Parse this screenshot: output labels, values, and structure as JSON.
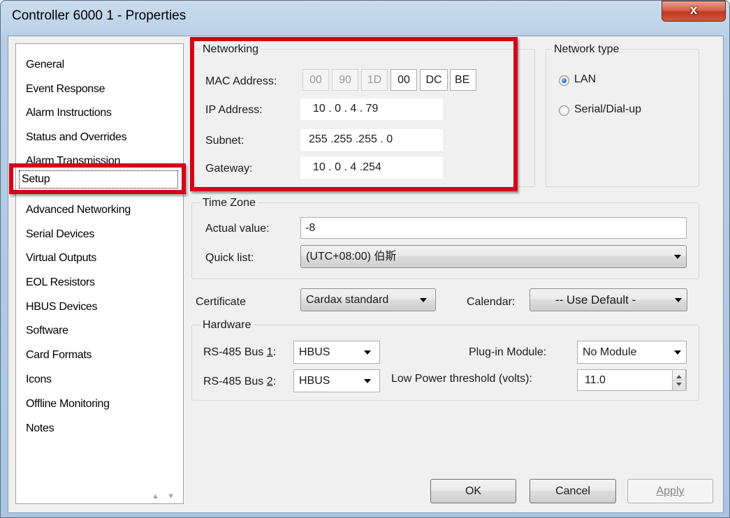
{
  "window": {
    "title": "Controller 6000 1 - Properties",
    "close_glyph": "x"
  },
  "nav": {
    "items": [
      {
        "label": "General"
      },
      {
        "label": "Event Response"
      },
      {
        "label": "Alarm Instructions"
      },
      {
        "label": "Status and Overrides"
      },
      {
        "label": "Alarm Transmission"
      },
      {
        "label": "Setup",
        "selected": true
      },
      {
        "label": "Advanced Networking"
      },
      {
        "label": "Serial Devices"
      },
      {
        "label": "Virtual Outputs"
      },
      {
        "label": "EOL Resistors"
      },
      {
        "label": "HBUS Devices"
      },
      {
        "label": "Software"
      },
      {
        "label": "Card Formats"
      },
      {
        "label": "Icons"
      },
      {
        "label": "Offline Monitoring"
      },
      {
        "label": "Notes"
      }
    ],
    "scroll_arrows": "▲ ▼"
  },
  "networking": {
    "title": "Networking",
    "mac_label": "MAC Address:",
    "mac": [
      "00",
      "90",
      "1D",
      "00",
      "DC",
      "BE"
    ],
    "ip_label": "IP Address:",
    "ip_value": "10 . 0 . 4 . 79",
    "subnet_label": "Subnet:",
    "subnet_value": "255 .255 .255 . 0",
    "gateway_label": "Gateway:",
    "gateway_value": "10 . 0 . 4 .254"
  },
  "network_type": {
    "title": "Network type",
    "options": [
      {
        "label": "LAN",
        "checked": true
      },
      {
        "label": "Serial/Dial-up",
        "checked": false
      }
    ]
  },
  "time_zone": {
    "title": "Time Zone",
    "actual_label": "Actual value:",
    "actual_value": "-8",
    "quick_label": "Quick list:",
    "quick_value": "(UTC+08:00) 伯斯"
  },
  "certificate": {
    "label": "Certificate",
    "value": "Cardax standard"
  },
  "calendar": {
    "label": "Calendar:",
    "value": "-- Use Default -"
  },
  "hardware": {
    "title": "Hardware",
    "bus1_label_pre": "RS-485 Bus ",
    "bus1_label_key": "1",
    "bus1_label_post": ":",
    "bus1_value": "HBUS",
    "bus2_label_pre": "RS-485 Bus ",
    "bus2_label_key": "2",
    "bus2_label_post": ":",
    "bus2_value": "HBUS",
    "plugin_label": "Plug-in Module:",
    "plugin_value": "No Module",
    "lowpower_label": "Low Power threshold (volts):",
    "lowpower_value": "11.0"
  },
  "buttons": {
    "ok": "OK",
    "cancel": "Cancel",
    "apply": "Apply"
  },
  "colors": {
    "highlight_box": "#d4001a",
    "title_bar": "#b7cfe6",
    "close_button": "#c0391f"
  }
}
